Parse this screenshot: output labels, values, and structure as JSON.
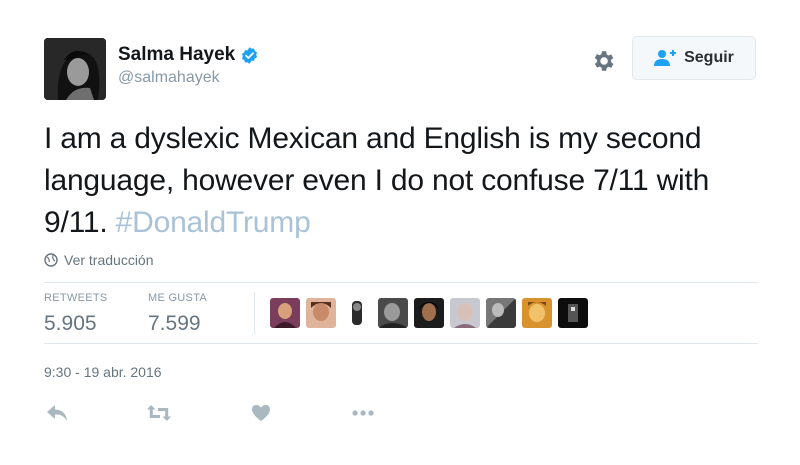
{
  "author": {
    "name": "Salma Hayek",
    "handle": "@salmahayek",
    "verified": true
  },
  "follow_button": {
    "label": "Seguir"
  },
  "tweet": {
    "text": "I am a dyslexic Mexican and English is my second language, however even I do not confuse 7/11 with 9/11.",
    "hashtag": "#DonaldTrump"
  },
  "translate": {
    "label": "Ver traducción"
  },
  "stats": {
    "retweets": {
      "label": "RETWEETS",
      "value": "5.905"
    },
    "likes": {
      "label": "ME GUSTA",
      "value": "7.599"
    }
  },
  "timestamp": "9:30 - 19 abr. 2016",
  "colors": {
    "hashtag": "#a9c2d8",
    "verified": "#1da1f2",
    "muted": "#8899a6",
    "icon": "#aab8c2"
  },
  "icons": {
    "verified": "verified-badge-icon",
    "settings": "gear-icon",
    "follow": "add-user-icon",
    "translate": "globe-icon",
    "reply": "reply-icon",
    "retweet": "retweet-icon",
    "like": "heart-icon",
    "more": "more-icon"
  }
}
